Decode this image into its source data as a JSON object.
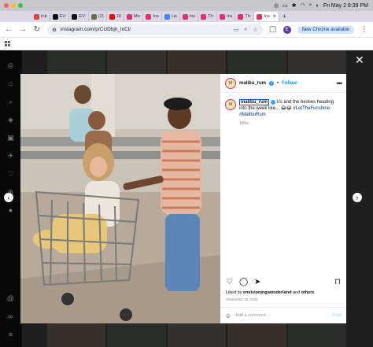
{
  "system": {
    "datetime": "Fri May 2  8:39 PM"
  },
  "browser": {
    "tabs": [
      {
        "label": "Inb",
        "color": "#ea4335"
      },
      {
        "label": "EV:",
        "color": "#111111"
      },
      {
        "label": "EV:",
        "color": "#111111"
      },
      {
        "label": "(2)",
        "color": "#6b6b47"
      },
      {
        "label": "18",
        "color": "#ff0000"
      },
      {
        "label": "Mic",
        "color": "#e1306c"
      },
      {
        "label": "Ins",
        "color": "#e1306c"
      },
      {
        "label": "Lis",
        "color": "#4285f4"
      },
      {
        "label": "Ins",
        "color": "#e1306c"
      },
      {
        "label": "Th:",
        "color": "#e1306c"
      },
      {
        "label": "Ins",
        "color": "#e1306c"
      },
      {
        "label": "Th:",
        "color": "#e1306c"
      },
      {
        "label": "Ins",
        "color": "#e1306c",
        "active": true
      }
    ],
    "url": "instagram.com/p/CUDbjh_lnCl/",
    "profile_initial": "E",
    "new_chrome_label": "New Chrome available"
  },
  "post": {
    "username": "malibu_rum",
    "follow_label": "Follow",
    "caption_username": "malibu_rum",
    "caption_text": " Us and the besties heading into the week like... ",
    "caption_emoji": "😂😂",
    "hashtags": [
      "#LetTheFunshine",
      "#MalibuRum"
    ],
    "caption_age": "186w",
    "liked_by_prefix": "Liked by ",
    "liked_by_user": "envisioningwonderland",
    "liked_by_suffix": " and ",
    "liked_by_others": "others",
    "date": "September 20, 2021",
    "comment_placeholder": "Add a comment...",
    "post_label": "Post"
  }
}
